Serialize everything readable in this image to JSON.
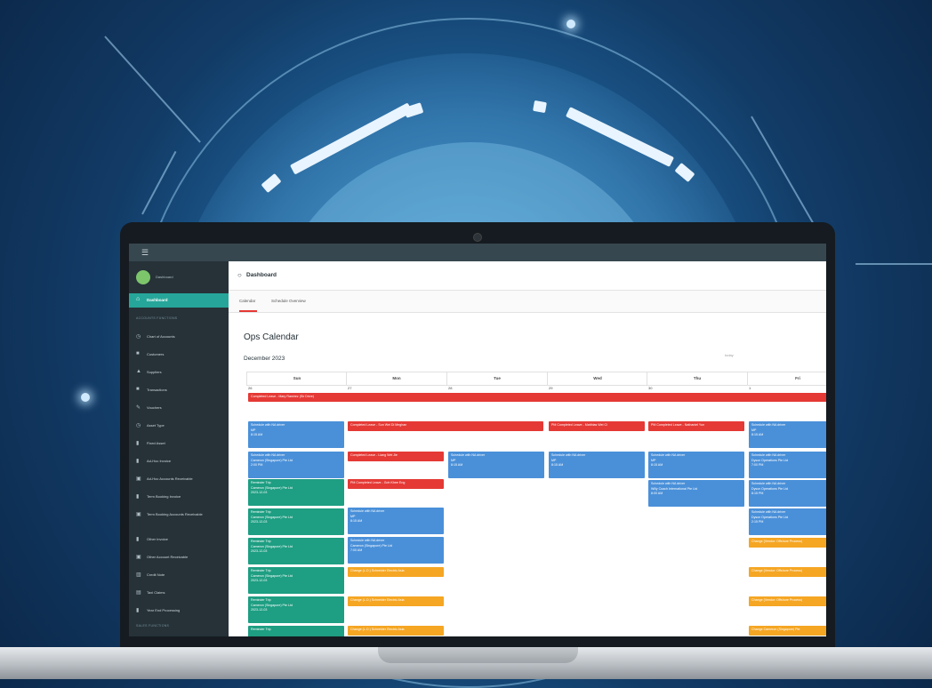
{
  "app": {
    "menu_icon": "hamburger-icon"
  },
  "sidebar": {
    "profile_label": "Dashboard",
    "active_item": {
      "label": "Dashboard",
      "icon": "home-icon"
    },
    "section_accounts": "ACCOUNTS FUNCTIONS",
    "items": [
      {
        "label": "Chart of Accounts",
        "icon": "chart-icon"
      },
      {
        "label": "Customers",
        "icon": "customers-icon"
      },
      {
        "label": "Suppliers",
        "icon": "suppliers-icon"
      },
      {
        "label": "Transactions",
        "icon": "transactions-icon"
      },
      {
        "label": "Vouchers",
        "icon": "voucher-icon"
      },
      {
        "label": "Asset Type",
        "icon": "asset-type-icon"
      },
      {
        "label": "Fixed Asset",
        "icon": "fixed-asset-icon"
      },
      {
        "label": "Ad-Hoc Invoice",
        "icon": "invoice-icon"
      },
      {
        "label": "Ad-Hoc Accounts Receivable",
        "icon": "receivable-icon"
      },
      {
        "label": "Term Booking Invoice",
        "icon": "invoice-icon"
      },
      {
        "label": "Term Booking Accounts Receivable",
        "icon": "receivable-icon"
      },
      {
        "label": "Other Invoice",
        "icon": "invoice-icon"
      },
      {
        "label": "Other Account Receivable",
        "icon": "receivable-icon"
      },
      {
        "label": "Credit Note",
        "icon": "credit-note-icon"
      },
      {
        "label": "Taxi Claims",
        "icon": "taxi-icon"
      },
      {
        "label": "Year End Processing",
        "icon": "year-end-icon"
      }
    ],
    "section_sales": "SALES FUNCTIONS"
  },
  "header": {
    "title": "Dashboard",
    "icon": "dashboard-icon"
  },
  "tabs": [
    {
      "label": "Calendar"
    },
    {
      "label": "Schedule Overview"
    }
  ],
  "calendar": {
    "title": "Ops Calendar",
    "month": "December 2023",
    "today_label": "today",
    "days": [
      "Sun",
      "Mon",
      "Tue",
      "Wed",
      "Thu",
      "Fri"
    ],
    "dates": [
      "26",
      "27",
      "28",
      "29",
      "30",
      "1"
    ]
  },
  "events": {
    "allday": "Completed Leave - Mary Ramirez (Sir Drive)",
    "sun": [
      {
        "lines": [
          "Schedule with NA driver",
          "MP",
          "8:15 AM"
        ]
      },
      {
        "lines": [
          "Schedule with NA driver",
          "Cameron (Singapore) Pte Ltd",
          "2:00 PM"
        ]
      },
      {
        "lines": [
          "Reminder Trip",
          "Cameron (Singapore) Pte Ltd",
          "2023-12-03"
        ]
      },
      {
        "lines": [
          "Reminder Trip",
          "Cameron (Singapore) Pte Ltd",
          "2023-12-03"
        ]
      },
      {
        "lines": [
          "Reminder Trip",
          "Cameron (Singapore) Pte Ltd",
          "2023-12-03"
        ]
      },
      {
        "lines": [
          "Reminder Trip",
          "Cameron (Singapore) Pte Ltd",
          "2023-12-03"
        ]
      },
      {
        "lines": [
          "Reminder Trip",
          "Cameron (Singapore) Pte Ltd",
          "2023-12-03"
        ]
      },
      {
        "lines": [
          "Reminder Trip"
        ]
      }
    ],
    "mon": [
      {
        "lines": [
          "Completed Leave - Sun Wei Di Meghan"
        ]
      },
      {
        "lines": [
          "Completed Leave - Liang Wei Jie"
        ]
      },
      {
        "lines": [
          "PM Completed Leave - Goh Khee Eng"
        ]
      },
      {
        "lines": [
          "Schedule with NA driver",
          "MP",
          "8:15 AM"
        ]
      },
      {
        "lines": [
          "Schedule with NA driver",
          "Cameron (Singapore) Pte Ltd",
          "7:00 AM"
        ]
      },
      {
        "lines": [
          "Change (L.O.) Schneider Electric Asia"
        ]
      },
      {
        "lines": [
          "Change (L.O.) Schneider Electric Asia"
        ]
      },
      {
        "lines": [
          "Change (L.O.) Schneider Electric Asia"
        ]
      }
    ],
    "tue": [
      {
        "lines": [
          "Schedule with NA driver",
          "MP",
          "8:15 AM"
        ]
      }
    ],
    "wed": [
      {
        "lines": [
          "PM Completed Leave - Matthias Wei Ci"
        ]
      },
      {
        "lines": [
          "Schedule with NA driver",
          "MP",
          "8:15 AM"
        ]
      }
    ],
    "thu": [
      {
        "lines": [
          "PM Completed Leave - Nathaniel Yun"
        ]
      },
      {
        "lines": [
          "Schedule with NA driver",
          "MP",
          "8:15 AM"
        ]
      },
      {
        "lines": [
          "Schedule with NA driver",
          "Willy Coach International Pte Ltd",
          "8:00 AM"
        ]
      }
    ],
    "fri": [
      {
        "lines": [
          "Schedule with NA driver",
          "MP",
          "8:15 AM"
        ]
      },
      {
        "lines": [
          "Schedule with NA driver",
          "Dyson Operations Pte Ltd",
          "7:00 PM"
        ]
      },
      {
        "lines": [
          "Schedule with NA driver",
          "Dyson Operations Pte Ltd",
          "8:15 PM"
        ]
      },
      {
        "lines": [
          "Schedule with NA driver",
          "Dyson Operations Pte Ltd",
          "2:15 PM"
        ]
      },
      {
        "lines": [
          "Change (Vendor: Offshore Process)"
        ]
      },
      {
        "lines": [
          "Change (Vendor: Offshore Process)"
        ]
      },
      {
        "lines": [
          "Change (Vendor: Offshore Process)"
        ]
      },
      {
        "lines": [
          "Change Cameron (Singapore) Pte"
        ]
      }
    ]
  }
}
